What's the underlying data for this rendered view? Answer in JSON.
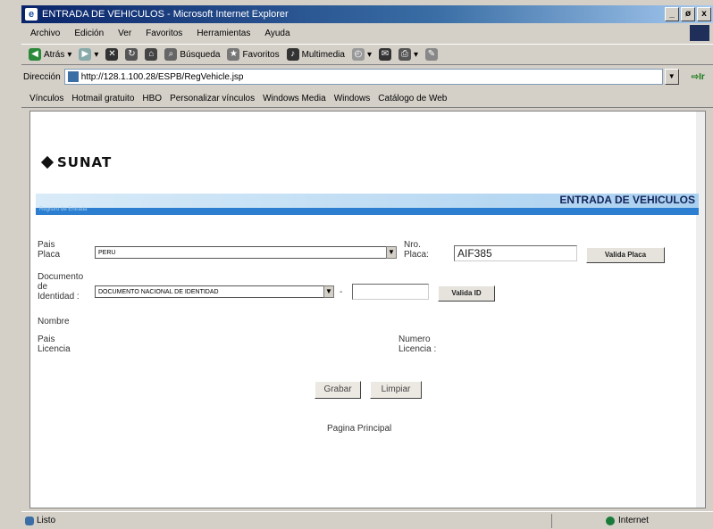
{
  "window": {
    "title": "ENTRADA DE VEHICULOS - Microsoft Internet Explorer",
    "minimize": "_",
    "maximize": "ø",
    "close": "x"
  },
  "menu": [
    "Archivo",
    "Edición",
    "Ver",
    "Favoritos",
    "Herramientas",
    "Ayuda"
  ],
  "toolbar": {
    "back": "Atrás",
    "search": "Búsqueda",
    "favorites": "Favoritos",
    "media": "Multimedia"
  },
  "address": {
    "label": "Dirección",
    "url": "http://128.1.100.28/ESPB/RegVehicle.jsp",
    "go": "Ir"
  },
  "links": [
    "Vínculos",
    "Hotmail gratuito",
    "HBO",
    "Personalizar vínculos",
    "Windows Media",
    "Windows",
    "Catálogo de Web"
  ],
  "page": {
    "logo_text": "SUNAT",
    "header_title": "ENTRADA DE VEHICULOS",
    "header_sub": "Registro de Entrada",
    "pais_placa_label": "Pais Placa",
    "pais_placa_value": "PERU",
    "nro_placa_label": "Nro. Placa:",
    "nro_placa_value": "AIF385",
    "valida_placa": "Valida Placa",
    "doc_label": "Documento de Identidad :",
    "doc_value": "DOCUMENTO NACIONAL DE IDENTIDAD",
    "dash": "-",
    "doc_number": "",
    "valida_id": "Valida ID",
    "nombre_label": "Nombre",
    "pais_licencia_label": "Pais Licencia",
    "numero_licencia_label": "Numero Licencia :",
    "grabar": "Grabar",
    "limpiar": "Limpiar",
    "pagina_principal": "Pagina Principal"
  },
  "status": {
    "left": "Listo",
    "zone": "Internet"
  },
  "colors": {
    "titlebar": "#0a246a",
    "banner_light": "#a9d0f0",
    "banner_dark": "#2c7fd0"
  },
  "icons": [
    "ie-icon",
    "back-icon",
    "forward-icon",
    "stop-icon",
    "refresh-icon",
    "home-icon",
    "search-icon",
    "favorites-icon",
    "media-icon",
    "history-icon",
    "mail-icon",
    "print-icon",
    "edit-icon",
    "page-icon",
    "globe-icon"
  ]
}
